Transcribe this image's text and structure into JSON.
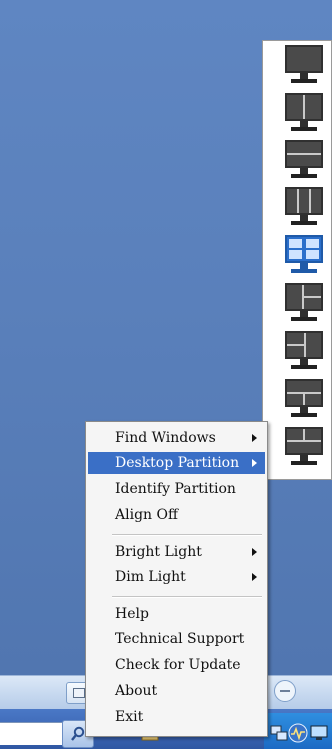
{
  "context_menu": {
    "items": [
      {
        "label": "Find Windows",
        "submenu": true
      },
      {
        "label": "Desktop Partition",
        "submenu": true,
        "highlighted": true
      },
      {
        "label": "Identify Partition",
        "submenu": false
      },
      {
        "label": "Align Off",
        "submenu": false
      },
      {
        "label": "Bright Light",
        "submenu": true
      },
      {
        "label": "Dim Light",
        "submenu": true
      },
      {
        "label": "Help",
        "submenu": false
      },
      {
        "label": "Technical Support",
        "submenu": false
      },
      {
        "label": "Check for Update",
        "submenu": false
      },
      {
        "label": "About",
        "submenu": false
      },
      {
        "label": "Exit",
        "submenu": false
      }
    ]
  },
  "partition_panel": {
    "selected_option": "four-quadrant-partition",
    "options": [
      "full-screen-partition",
      "two-column-partition",
      "two-row-partition",
      "three-column-partition",
      "four-quadrant-partition",
      "left-plus-two-right-partition",
      "two-left-plus-right-partition",
      "top-plus-two-bottom-partition",
      "two-top-plus-bottom-partition"
    ]
  },
  "colors": {
    "desktop": "#5a80bb",
    "menu_highlight": "#3a6fc6",
    "menu_background": "#f5f5f5",
    "taskbar": "#3b65b3"
  },
  "icons": [
    "search-icon",
    "folder-icon",
    "chevron-down-icon",
    "network-icon",
    "audio-icon",
    "display-icon"
  ]
}
